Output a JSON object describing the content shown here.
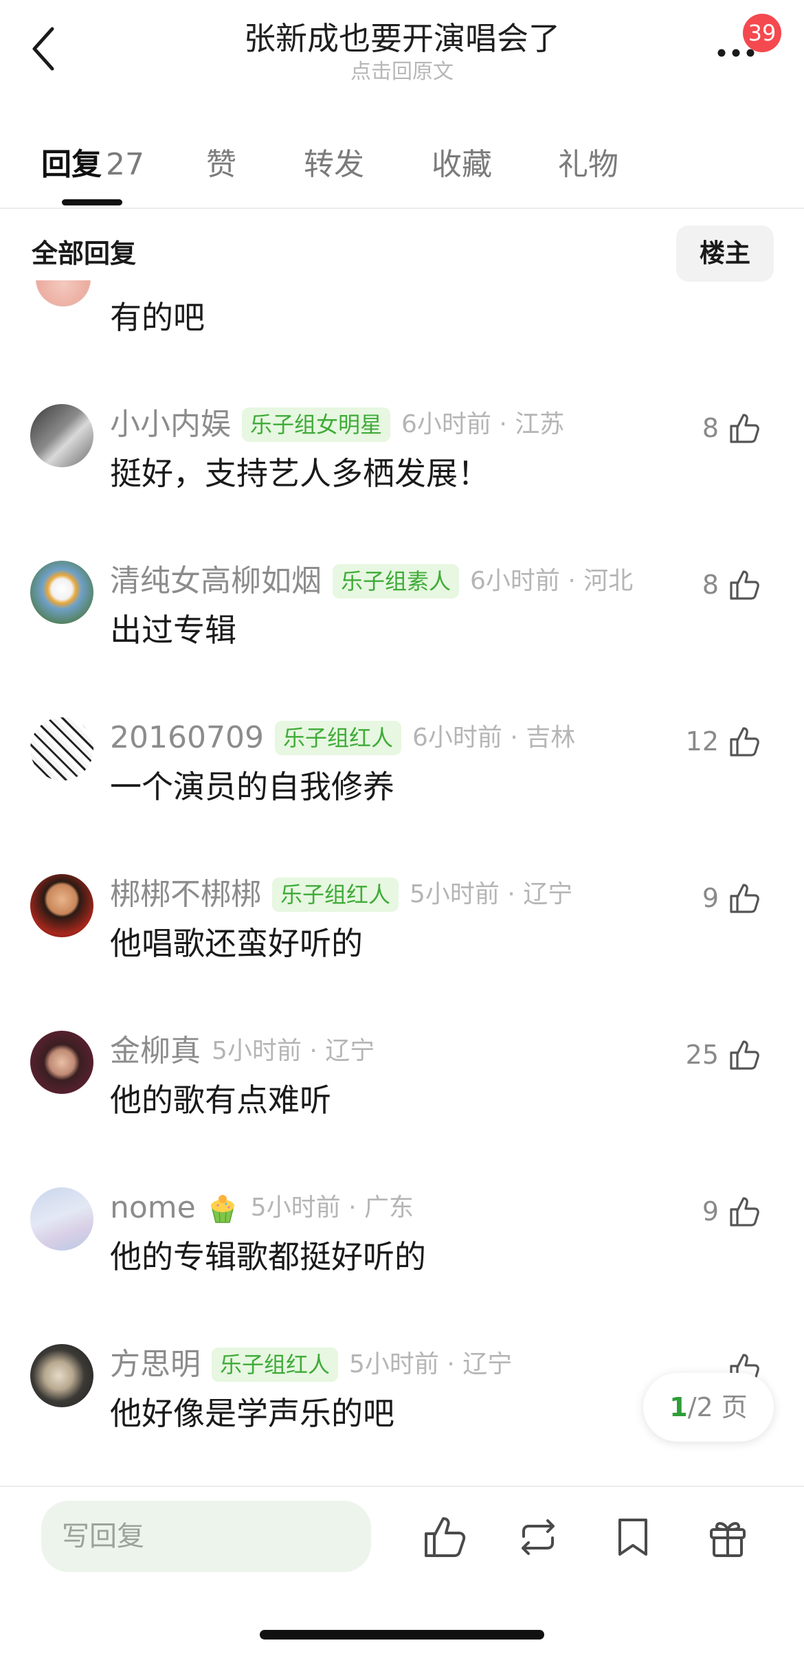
{
  "header": {
    "title": "张新成也要开演唱会了",
    "subtitle": "点击回原文",
    "badge_count": "39"
  },
  "tabs": [
    {
      "label": "回复",
      "count": "27",
      "active": true
    },
    {
      "label": "赞"
    },
    {
      "label": "转发"
    },
    {
      "label": "收藏"
    },
    {
      "label": "礼物"
    }
  ],
  "section": {
    "title": "全部回复",
    "op_button": "楼主"
  },
  "first_comment": {
    "text": "有的吧"
  },
  "comments": [
    {
      "username": "小小内娱",
      "tag": "乐子组女明星",
      "time": "6小时前 · 江苏",
      "text": "挺好，支持艺人多栖发展！",
      "likes": "8"
    },
    {
      "username": "清纯女高柳如烟",
      "tag": "乐子组素人",
      "time": "6小时前 · 河北",
      "text": "出过专辑",
      "likes": "8"
    },
    {
      "username": "20160709",
      "tag": "乐子组红人",
      "time": "6小时前 · 吉林",
      "text": "一个演员的自我修养",
      "likes": "12"
    },
    {
      "username": "梆梆不梆梆",
      "tag": "乐子组红人",
      "time": "5小时前 · 辽宁",
      "text": "他唱歌还蛮好听的",
      "likes": "9"
    },
    {
      "username": "金柳真",
      "time": "5小时前 · 辽宁",
      "text": "他的歌有点难听",
      "likes": "25"
    },
    {
      "username": "nome",
      "emoji": "cupcake-emoji",
      "time": "5小时前 · 广东",
      "text": "他的专辑歌都挺好听的",
      "likes": "9"
    },
    {
      "username": "方思明",
      "tag": "乐子组红人",
      "time": "5小时前 · 辽宁",
      "text": "他好像是学声乐的吧",
      "likes": ""
    }
  ],
  "pager": {
    "current": "1",
    "total_text": "/2 页"
  },
  "bottom_bar": {
    "reply_placeholder": "写回复",
    "icons": [
      "thumb-up-icon",
      "repost-icon",
      "bookmark-icon",
      "gift-icon"
    ]
  },
  "colors": {
    "tag_bg": "#e7f7e1",
    "tag_text": "#3fab38",
    "badge": "#f4494f",
    "input_bg": "#edf4ec",
    "pager_current": "#2f9e3a"
  }
}
